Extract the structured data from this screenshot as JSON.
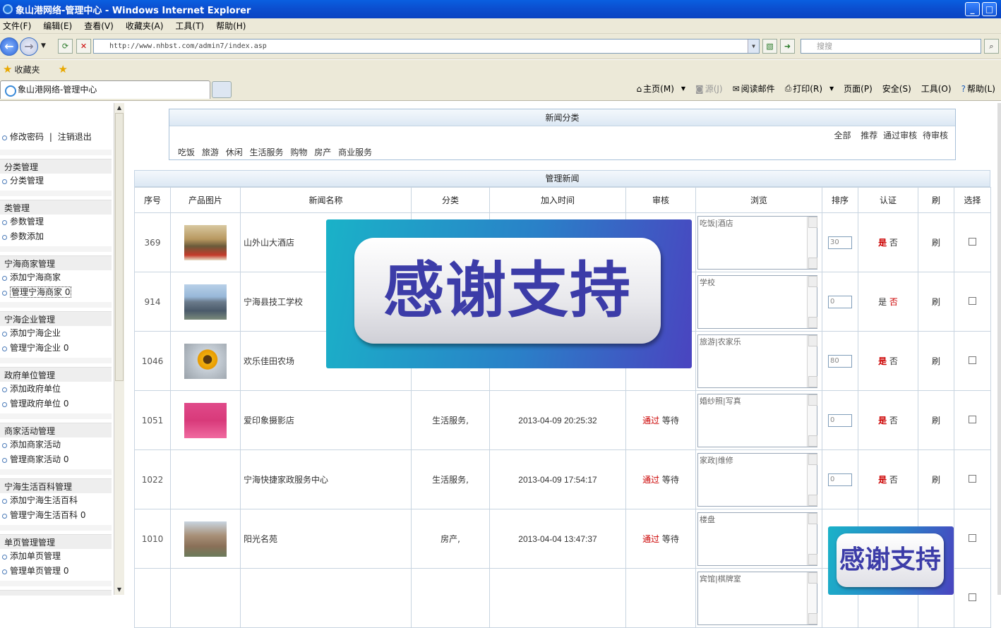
{
  "window": {
    "title": "象山港网络-管理中心 - Windows Internet Explorer"
  },
  "menu": [
    "文件(F)",
    "编辑(E)",
    "查看(V)",
    "收藏夹(A)",
    "工具(T)",
    "帮助(H)"
  ],
  "address": {
    "url": "http://www.nhbst.com/admin7/index.asp",
    "search_placeholder": "搜搜"
  },
  "favorites": {
    "label": "收藏夹"
  },
  "tab": {
    "title": "象山港网络-管理中心"
  },
  "commands": [
    "主页(M)",
    "源(J)",
    "阅读邮件",
    "打印(R)",
    "页面(P)",
    "安全(S)",
    "工具(O)",
    "帮助(L)"
  ],
  "sidebar": {
    "top_links": {
      "change_password": "修改密码",
      "sep": "|",
      "logout": "注销退出"
    },
    "sections": [
      {
        "title": "分类管理",
        "links": [
          "分类管理"
        ]
      },
      {
        "title": "类管理",
        "links": [
          "参数管理",
          "参数添加"
        ]
      },
      {
        "title": "宁海商家管理",
        "links": [
          "添加宁海商家",
          "管理宁海商家 0"
        ]
      },
      {
        "title": "宁海企业管理",
        "links": [
          "添加宁海企业",
          "管理宁海企业 0"
        ]
      },
      {
        "title": "政府单位管理",
        "links": [
          "添加政府单位",
          "管理政府单位 0"
        ]
      },
      {
        "title": "商家活动管理",
        "links": [
          "添加商家活动",
          "管理商家活动 0"
        ]
      },
      {
        "title": "宁海生活百科管理",
        "links": [
          "添加宁海生活百科",
          "管理宁海生活百科 0"
        ]
      },
      {
        "title": "单页管理管理",
        "links": [
          "添加单页管理",
          "管理单页管理 0"
        ]
      }
    ]
  },
  "news_category": {
    "title": "新闻分类",
    "filters": [
      "全部",
      "推荐",
      "通过审核",
      "待审核"
    ],
    "categories": [
      "吃饭",
      "旅游",
      "休闲",
      "生活服务",
      "购物",
      "房产",
      "商业服务"
    ]
  },
  "manage_news": {
    "title": "管理新闻",
    "headers": [
      "序号",
      "产品图片",
      "新闻名称",
      "分类",
      "加入时间",
      "审核",
      "浏览",
      "排序",
      "认证",
      "刷",
      "选择"
    ],
    "rows": [
      {
        "id": "369",
        "name": "山外山大酒店",
        "category": "",
        "time": "",
        "approve": "",
        "wait": "",
        "browse": "吃饭|酒店",
        "rank": "30",
        "yes": "是",
        "no": "否",
        "yes_red": true,
        "refresh": "刷",
        "img": "hotel"
      },
      {
        "id": "914",
        "name": "宁海县技工学校",
        "category": "",
        "time": "",
        "approve": "",
        "wait": "",
        "browse": "学校",
        "rank": "0",
        "yes": "是",
        "no": "否",
        "yes_red": false,
        "refresh": "刷",
        "img": "school"
      },
      {
        "id": "1046",
        "name": "欢乐佳田农场",
        "category": "",
        "time": "",
        "approve": "",
        "wait": "",
        "browse": "旅游|农家乐",
        "rank": "80",
        "yes": "是",
        "no": "否",
        "yes_red": true,
        "refresh": "刷",
        "img": "flower"
      },
      {
        "id": "1051",
        "name": "爱印象摄影店",
        "category": "生活服务,",
        "time": "2013-04-09 20:25:32",
        "approve": "通过",
        "wait": "等待",
        "browse": "婚纱照|写真",
        "rank": "0",
        "yes": "是",
        "no": "否",
        "yes_red": true,
        "refresh": "刷",
        "img": "photo"
      },
      {
        "id": "1022",
        "name": "宁海快捷家政服务中心",
        "category": "生活服务,",
        "time": "2013-04-09 17:54:17",
        "approve": "通过",
        "wait": "等待",
        "browse": "家政|维修",
        "rank": "0",
        "yes": "是",
        "no": "否",
        "yes_red": true,
        "refresh": "刷",
        "img": ""
      },
      {
        "id": "1010",
        "name": "阳光名苑",
        "category": "房产,",
        "time": "2013-04-04 13:47:37",
        "approve": "通过",
        "wait": "等待",
        "browse": "楼盘",
        "rank": "",
        "yes": "",
        "no": "",
        "yes_red": true,
        "refresh": "",
        "img": "building"
      },
      {
        "id": "",
        "name": "",
        "category": "",
        "time": "",
        "approve": "",
        "wait": "",
        "browse": "宾馆|棋牌室",
        "rank": "",
        "yes": "",
        "no": "",
        "yes_red": true,
        "refresh": "",
        "img": ""
      }
    ]
  },
  "overlay": {
    "text": "感谢支持",
    "text_small": "感谢支持"
  },
  "colors": {
    "title_bar": "#0a5fe0",
    "accent_red": "#cc0000",
    "banner_text": "#3c3ca8"
  }
}
